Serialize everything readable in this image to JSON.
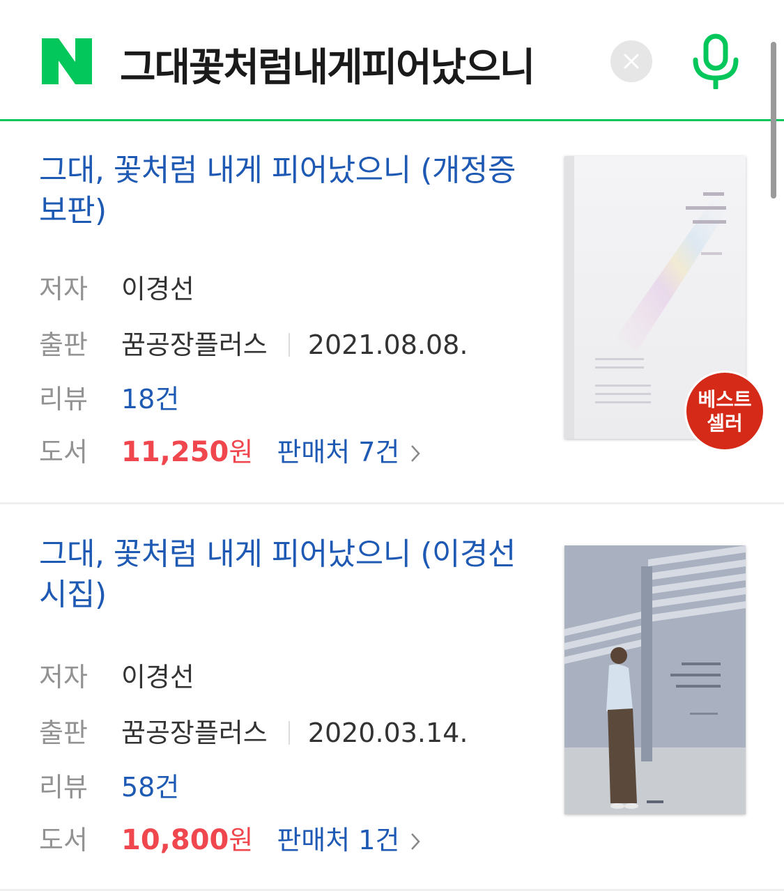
{
  "search": {
    "query": "그대꽃처럼내게피어났으니",
    "logo_icon": "naver-n-icon",
    "clear_icon": "clear-icon",
    "mic_icon": "microphone-icon",
    "brand_color": "#03c75a"
  },
  "results": [
    {
      "title": "그대, 꽃처럼 내게 피어났으니 (개정증보판)",
      "author_label": "저자",
      "author": "이경선",
      "publisher_label": "출판",
      "publisher": "꿈공장플러스",
      "date": "2021.08.08.",
      "review_label": "리뷰",
      "review_count": "18건",
      "book_label": "도서",
      "price": "11,250",
      "price_unit": "원",
      "sellers": "판매처 7건",
      "badge_line1": "베스트",
      "badge_line2": "셀러"
    },
    {
      "title": "그대, 꽃처럼 내게 피어났으니 (이경선 시집)",
      "author_label": "저자",
      "author": "이경선",
      "publisher_label": "출판",
      "publisher": "꿈공장플러스",
      "date": "2020.03.14.",
      "review_label": "리뷰",
      "review_count": "58건",
      "book_label": "도서",
      "price": "10,800",
      "price_unit": "원",
      "sellers": "판매처 1건"
    }
  ]
}
